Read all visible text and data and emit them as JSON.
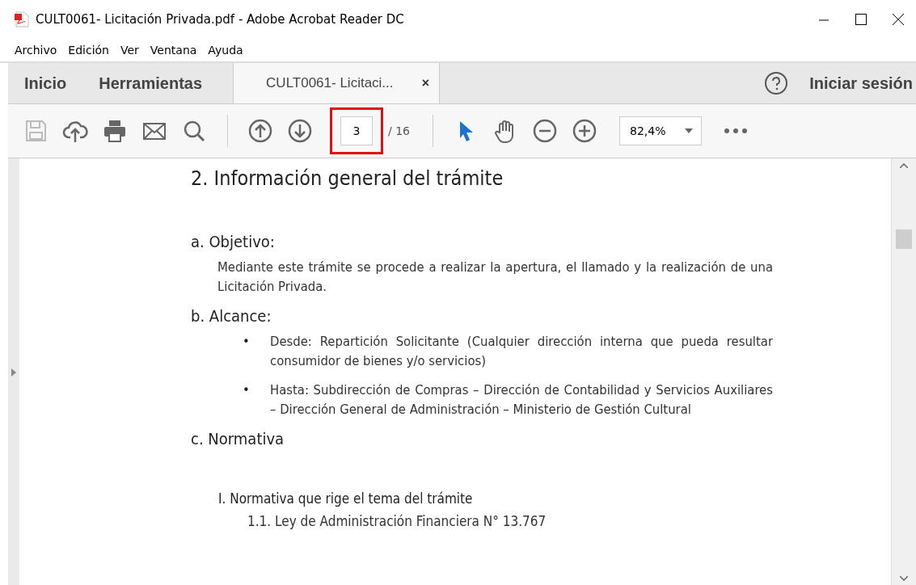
{
  "window": {
    "title": "CULT0061- Licitación Privada.pdf - Adobe Acrobat Reader DC"
  },
  "menu": [
    "Archivo",
    "Edición",
    "Ver",
    "Ventana",
    "Ayuda"
  ],
  "tabs": [
    {
      "label": "Inicio",
      "selected": false
    },
    {
      "label": "Herramientas",
      "selected": false
    },
    {
      "label": "CULT0061- Licitaci...",
      "selected": true,
      "close": "×"
    }
  ],
  "account": {
    "label": "Iniciar sesión"
  },
  "toolbar": {
    "page": "3",
    "page_total": "/ 16",
    "zoom": "82,4%",
    "select_active": true,
    "page_highlighted": true
  },
  "document": {
    "heading": "2. Información general del trámite",
    "sections": [
      {
        "kind": "paragraph",
        "title": "a. Objetivo:",
        "text": "Mediante este trámite se procede a realizar la apertura, el llamado y la realización de una Licitación Privada."
      },
      {
        "kind": "bullets",
        "title": "b. Alcance:",
        "items": [
          {
            "bullet": "•",
            "text": "Desde: Repartición Solicitante (Cualquier dirección interna que pueda resultar consumidor de bienes y/o servicios)"
          },
          {
            "bullet": "•",
            "text": "Hasta: Subdirección de Compras – Dirección de Contabilidad y Servicios Auxiliares – Dirección General de Administración – Ministerio de Gestión Cultural"
          }
        ]
      },
      {
        "kind": "outline",
        "title": "c. Normativa",
        "subtitle": "I. Normativa que rige el tema del trámite",
        "items": [
          "1.1. Ley de Administración Financiera N° 13.767"
        ]
      }
    ]
  }
}
